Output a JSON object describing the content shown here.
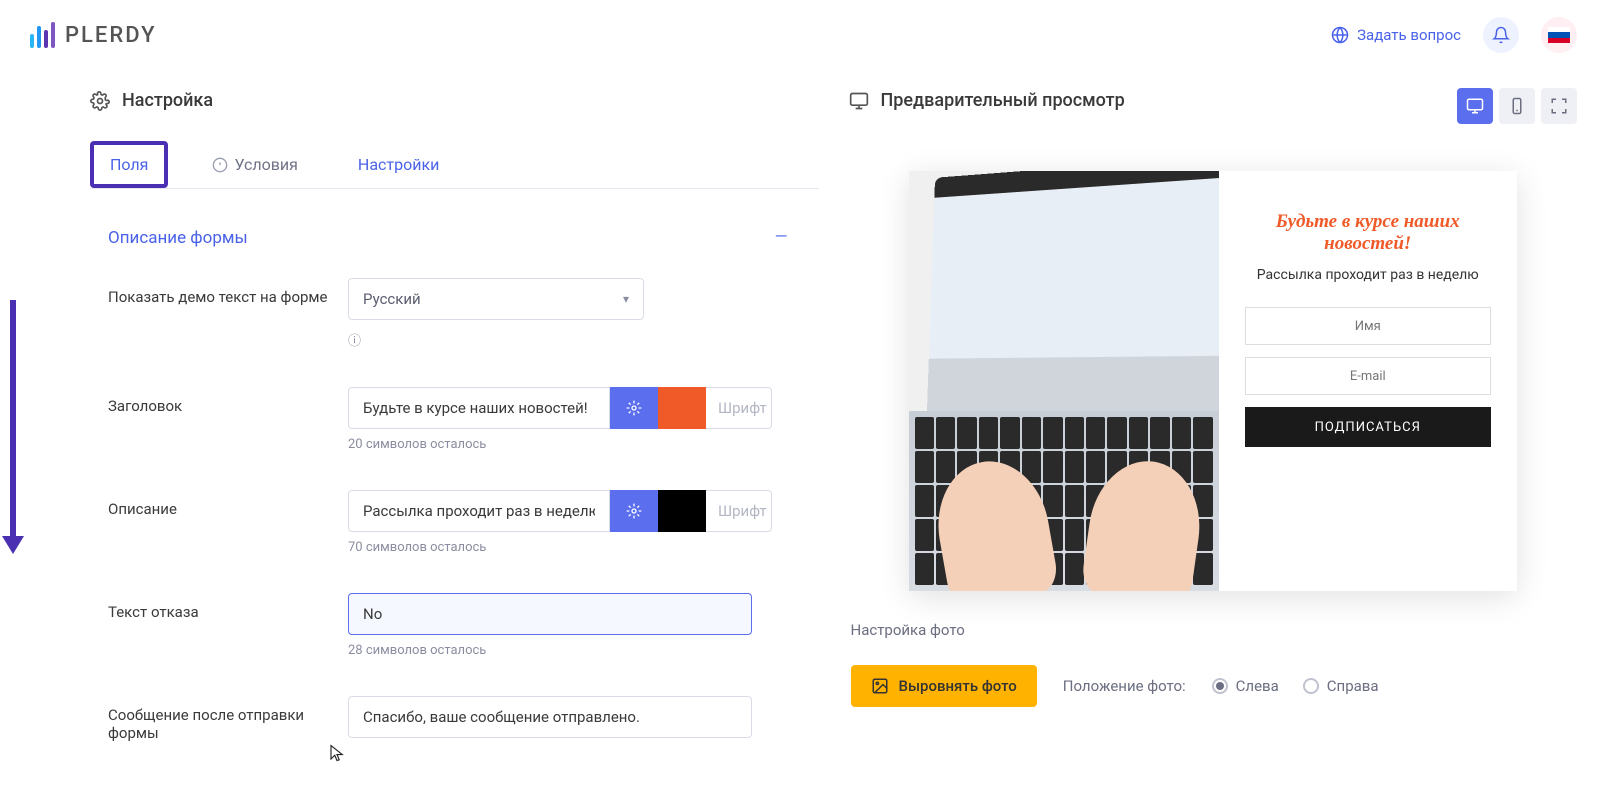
{
  "brand": "PLERDY",
  "header": {
    "ask_question": "Задать вопрос"
  },
  "settings": {
    "title": "Настройка",
    "tabs": {
      "fields": "Поля",
      "conditions": "Условия",
      "settings": "Настройки"
    },
    "accordion_title": "Описание формы",
    "demo_text_label": "Показать демо текст на форме",
    "demo_text_value": "Русский",
    "title_label": "Заголовок",
    "title_value": "Будьте в курсе наших новостей!",
    "title_counter": "20 символов осталось",
    "desc_label": "Описание",
    "desc_value": "Рассылка проходит раз в неделю",
    "desc_counter": "70 символов осталось",
    "reject_label": "Текст отказа",
    "reject_value": "No",
    "reject_counter": "28 символов осталось",
    "sent_label": "Сообщение после отправки формы",
    "sent_value": "Спасибо, ваше сообщение отправлено.",
    "font_placeholder": "Шрифт",
    "title_color": "#f05a28",
    "desc_color": "#000000"
  },
  "preview": {
    "title": "Предварительный просмотр",
    "popup_title": "Будьте в курсе наших новостей!",
    "popup_desc": "Рассылка проходит раз в неделю",
    "name_placeholder": "Имя",
    "email_placeholder": "E-mail",
    "submit_label": "ПОДПИСАТЬСЯ"
  },
  "photo": {
    "title": "Настройка фото",
    "align_btn": "Выровнять фото",
    "position_label": "Положение фото:",
    "left": "Слева",
    "right": "Справа"
  }
}
